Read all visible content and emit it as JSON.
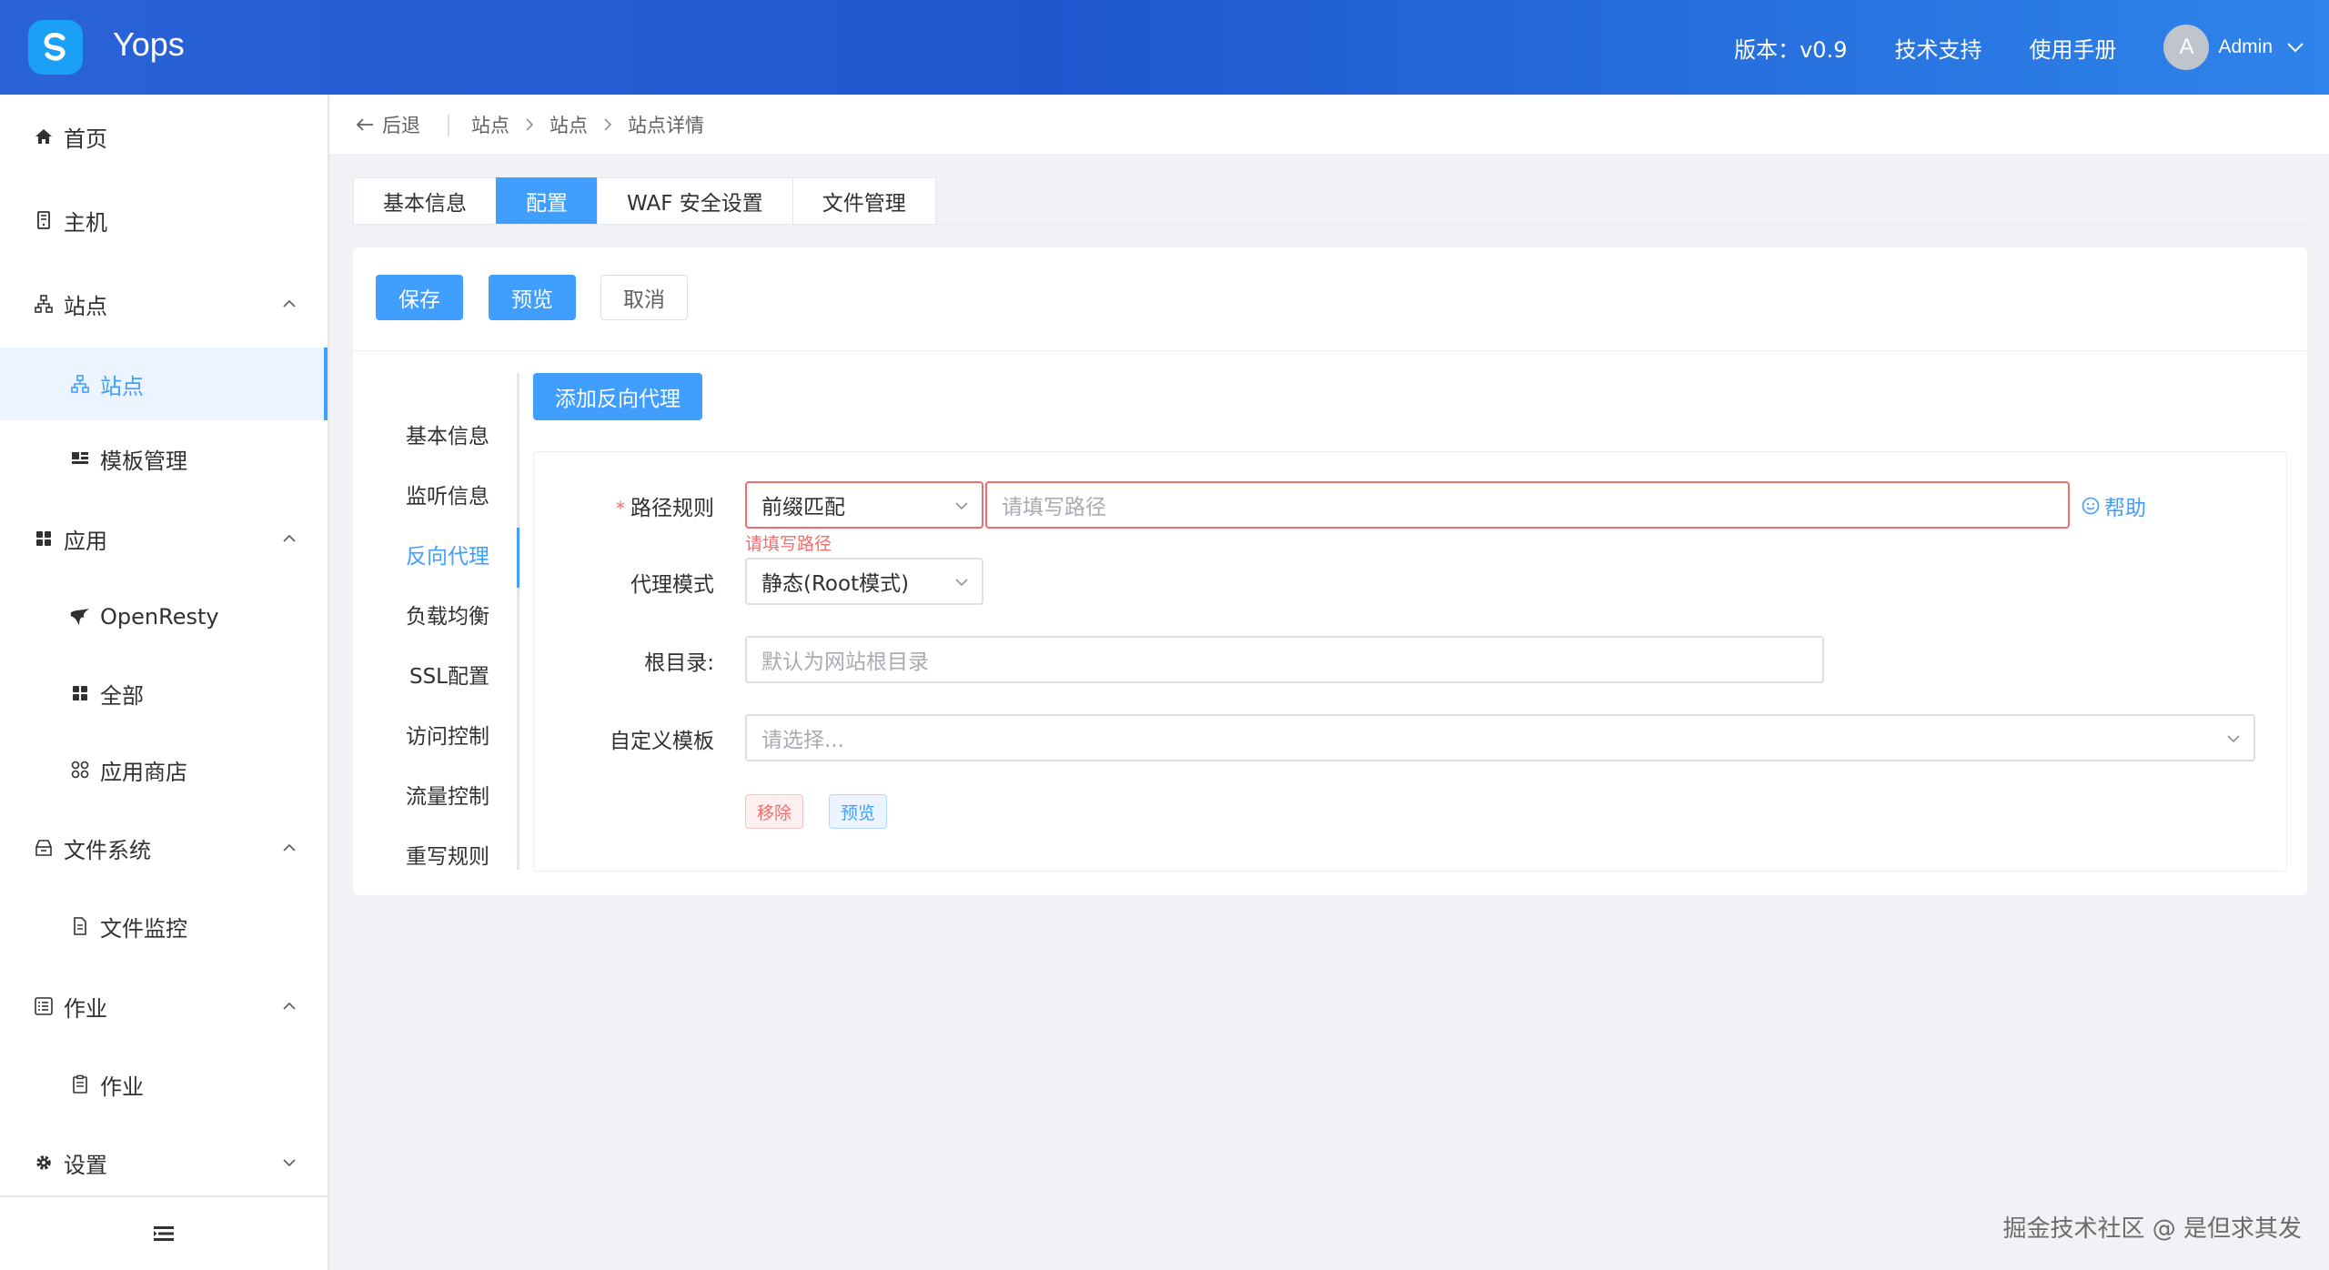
{
  "header": {
    "app_title": "Yops",
    "version_label": "版本：v0.9",
    "support_label": "技术支持",
    "manual_label": "使用手册",
    "avatar_letter": "A",
    "user_name": "Admin"
  },
  "sidebar": {
    "items": [
      {
        "label": "首页",
        "icon": "home-icon"
      },
      {
        "label": "主机",
        "icon": "server-icon"
      },
      {
        "label": "站点",
        "icon": "sitemap-icon"
      },
      {
        "label": "站点",
        "icon": "sitemap-icon"
      },
      {
        "label": "模板管理",
        "icon": "template-icon"
      },
      {
        "label": "应用",
        "icon": "apps-icon"
      },
      {
        "label": "OpenResty",
        "icon": "openresty-icon"
      },
      {
        "label": "全部",
        "icon": "apps-icon"
      },
      {
        "label": "应用商店",
        "icon": "store-icon"
      },
      {
        "label": "文件系统",
        "icon": "filesystem-icon"
      },
      {
        "label": "文件监控",
        "icon": "file-monitor-icon"
      },
      {
        "label": "作业",
        "icon": "task-list-icon"
      },
      {
        "label": "作业",
        "icon": "clipboard-icon"
      },
      {
        "label": "设置",
        "icon": "gear-icon"
      }
    ]
  },
  "breadcrumb": {
    "back_label": "后退",
    "items": [
      "站点",
      "站点",
      "站点详情"
    ]
  },
  "tabs": [
    "基本信息",
    "配置",
    "WAF 安全设置",
    "文件管理"
  ],
  "toolbar": {
    "save_label": "保存",
    "preview_label": "预览",
    "cancel_label": "取消"
  },
  "sub_nav": [
    "基本信息",
    "监听信息",
    "反向代理",
    "负载均衡",
    "SSL配置",
    "访问控制",
    "流量控制",
    "重写规则"
  ],
  "proxy": {
    "add_label": "添加反向代理",
    "path_rule_label": "路径规则",
    "path_rule_value": "前缀匹配",
    "path_placeholder": "请填写路径",
    "path_error": "请填写路径",
    "help_label": "帮助",
    "mode_label": "代理模式",
    "mode_value": "静态(Root模式)",
    "root_label": "根目录:",
    "root_placeholder": "默认为网站根目录",
    "template_label": "自定义模板",
    "template_placeholder": "请选择...",
    "remove_label": "移除",
    "preview_label": "预览"
  },
  "watermark": "掘金技术社区 @ 是但求其发",
  "colors": {
    "accent": "#409eff",
    "error": "#f56c6c",
    "header_start": "#2a63d8",
    "header_end": "#2e84ea"
  }
}
